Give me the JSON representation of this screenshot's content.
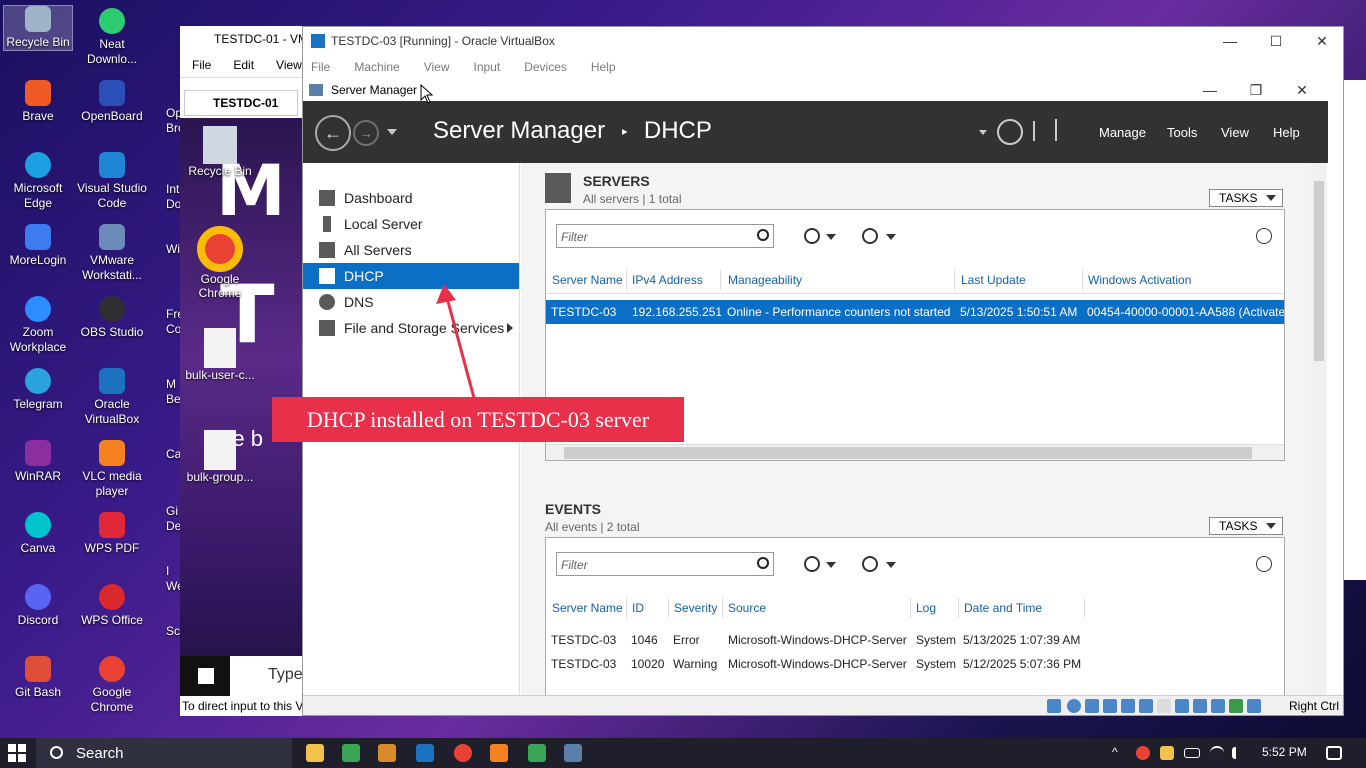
{
  "desktop_icons": [
    {
      "label": "Recycle Bin",
      "color": "#9fb4c8"
    },
    {
      "label": "Neat Downlo...",
      "color": "#2ecc71"
    },
    {
      "label": "Brave",
      "color": "#f05a24"
    },
    {
      "label": "OpenBoard",
      "color": "#2a4fb8"
    },
    {
      "label": "Microsoft Edge",
      "color": "#1ba0e2"
    },
    {
      "label": "Visual Studio Code",
      "color": "#1f86d6"
    },
    {
      "label": "MoreLogin",
      "color": "#3d7cf0"
    },
    {
      "label": "VMware Workstati...",
      "color": "#6c8bb8"
    },
    {
      "label": "Zoom Workplace",
      "color": "#2d8cff"
    },
    {
      "label": "OBS Studio",
      "color": "#302e31"
    },
    {
      "label": "Telegram",
      "color": "#2aa3dd"
    },
    {
      "label": "Oracle VirtualBox",
      "color": "#1b72be"
    },
    {
      "label": "WinRAR",
      "color": "#8b2fa0"
    },
    {
      "label": "VLC media player",
      "color": "#f58220"
    },
    {
      "label": "Canva",
      "color": "#00c4cc"
    },
    {
      "label": "WPS PDF",
      "color": "#e0283a"
    },
    {
      "label": "Discord",
      "color": "#5865f2"
    },
    {
      "label": "WPS Office",
      "color": "#d9282e"
    },
    {
      "label": "Git Bash",
      "color": "#e04e39"
    },
    {
      "label": "Google Chrome",
      "color": "#e94235"
    }
  ],
  "partial_labels": [
    "Op",
    "Bro",
    "Int",
    "Dov",
    "Win",
    "Free",
    "Com",
    "M",
    "Bea",
    "Ca",
    "Gi",
    "De",
    "I",
    "We",
    "Sc"
  ],
  "bg_window": {
    "title": "TESTDC-01 - VM",
    "menu": [
      "File",
      "Edit",
      "View"
    ],
    "tab": "TESTDC-01",
    "guest_icons": [
      "Recycle Bin",
      "Google Chrome",
      "bulk-user-c...",
      "bulk-group..."
    ],
    "guest_type": "Type",
    "status": "To direct input to this V",
    "big_text": [
      "M",
      "T"
    ],
    "we_text": "We b"
  },
  "vbox": {
    "title": "TESTDC-03 [Running] - Oracle VirtualBox",
    "menu": [
      "File",
      "Machine",
      "View",
      "Input",
      "Devices",
      "Help"
    ],
    "host_key": "Right Ctrl"
  },
  "server_manager": {
    "window_title": "Server Manager",
    "breadcrumb_root": "Server Manager",
    "breadcrumb_sep": "‣",
    "breadcrumb_page": "DHCP",
    "menu": [
      "Manage",
      "Tools",
      "View",
      "Help"
    ],
    "sidebar": [
      "Dashboard",
      "Local Server",
      "All Servers",
      "DHCP",
      "DNS",
      "File and Storage Services"
    ],
    "active": "DHCP",
    "servers": {
      "title": "SERVERS",
      "subtitle": "All servers | 1 total",
      "tasks": "TASKS",
      "filter_placeholder": "Filter",
      "columns": [
        "Server Name",
        "IPv4 Address",
        "Manageability",
        "Last Update",
        "Windows Activation"
      ],
      "rows": [
        [
          "TESTDC-03",
          "192.168.255.251",
          "Online - Performance counters not started",
          "5/13/2025 1:50:51 AM",
          "00454-40000-00001-AA588 (Activated)"
        ]
      ]
    },
    "events": {
      "title": "EVENTS",
      "subtitle": "All events | 2 total",
      "tasks": "TASKS",
      "filter_placeholder": "Filter",
      "columns": [
        "Server Name",
        "ID",
        "Severity",
        "Source",
        "Log",
        "Date and Time"
      ],
      "rows": [
        [
          "TESTDC-03",
          "1046",
          "Error",
          "Microsoft-Windows-DHCP-Server",
          "System",
          "5/13/2025 1:07:39 AM"
        ],
        [
          "TESTDC-03",
          "10020",
          "Warning",
          "Microsoft-Windows-DHCP-Server",
          "System",
          "5/12/2025 5:07:36 PM"
        ]
      ]
    }
  },
  "callout": "DHCP installed on TESTDC-03 server",
  "taskbar": {
    "search": "Search",
    "time": "5:52 PM"
  },
  "colors": {
    "accent": "#0b6fc6",
    "header": "#323232",
    "callout": "#e8304a"
  }
}
